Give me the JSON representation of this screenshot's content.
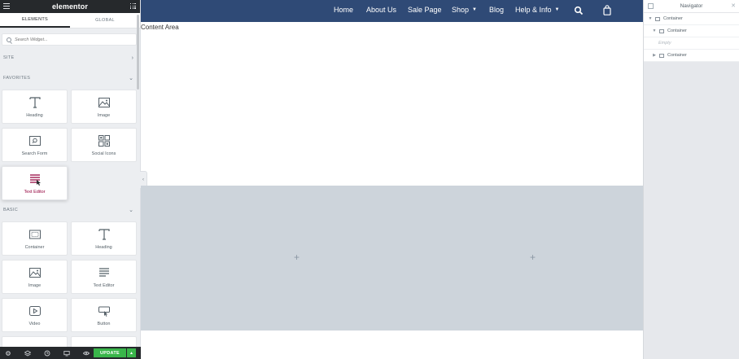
{
  "panel": {
    "logo": "elementor",
    "tabs": [
      "ELEMENTS",
      "GLOBAL"
    ],
    "search_placeholder": "Search Widget...",
    "sections": {
      "site": "SITE",
      "favorites": "FAVORITES",
      "basic": "BASIC"
    },
    "favorites": [
      {
        "label": "Heading",
        "icon": "heading-icon"
      },
      {
        "label": "Image",
        "icon": "image-icon"
      },
      {
        "label": "Search Form",
        "icon": "search-form-icon"
      },
      {
        "label": "Social Icons",
        "icon": "social-icons-icon"
      },
      {
        "label": "Text Editor",
        "icon": "text-editor-icon"
      }
    ],
    "basic": [
      {
        "label": "Container",
        "icon": "container-icon"
      },
      {
        "label": "Heading",
        "icon": "heading-icon"
      },
      {
        "label": "Image",
        "icon": "image-icon"
      },
      {
        "label": "Text Editor",
        "icon": "text-editor-icon"
      },
      {
        "label": "Video",
        "icon": "video-icon"
      },
      {
        "label": "Button",
        "icon": "button-icon"
      }
    ],
    "footer": {
      "update_label": "UPDATE"
    }
  },
  "site": {
    "menu": [
      "Home",
      "About Us",
      "Sale Page",
      "Shop",
      "Blog",
      "Help & Info"
    ],
    "content_label": "Content Area"
  },
  "navigator": {
    "title": "Navigator",
    "tree": [
      {
        "label": "Container",
        "depth": 0
      },
      {
        "label": "Container",
        "depth": 1
      },
      {
        "label": "Empty",
        "depth": 2
      },
      {
        "label": "Container",
        "depth": 1
      }
    ]
  },
  "colors": {
    "nav_bar": "#2f4a76",
    "panel_header": "#26292c",
    "update_green": "#39b54a",
    "container_bg": "#cdd4db",
    "active_widget_label": "#93003c"
  }
}
